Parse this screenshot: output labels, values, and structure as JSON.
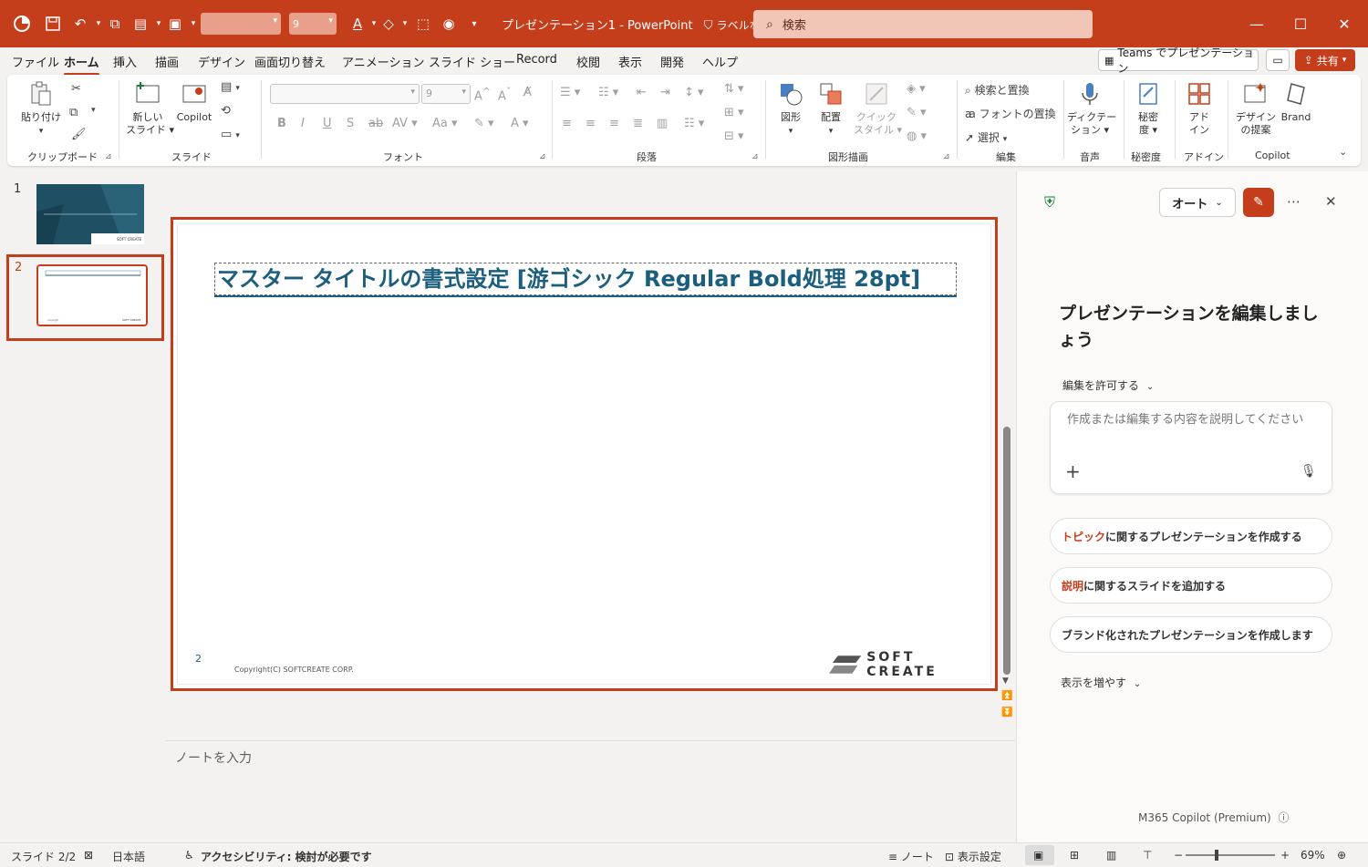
{
  "colors": {
    "accent": "#c43e1c",
    "title_text": "#1b5e7e",
    "slide1_bg": "#1f4f63"
  },
  "titlebar": {
    "doc_title": "プレゼンテーション1 - PowerPoint",
    "sensitivity": "ラベルなし",
    "search_placeholder": "検索",
    "font_size_value": "9"
  },
  "tabs": [
    "ファイル",
    "ホーム",
    "挿入",
    "描画",
    "デザイン",
    "画面切り替え",
    "アニメーション",
    "スライド ショー",
    "Record",
    "校閲",
    "表示",
    "開発",
    "ヘルプ"
  ],
  "active_tab": "ホーム",
  "tabbar_right": {
    "teams": "Teams でプレゼンテーション",
    "share": "共有"
  },
  "ribbon": {
    "groups": {
      "clipboard": "クリップボード",
      "slides": "スライド",
      "font": "フォント",
      "paragraph": "段落",
      "drawing": "図形描画",
      "editing": "編集",
      "voice": "音声",
      "sensitivity": "秘密度",
      "addins": "アドイン",
      "copilot": "Copilot"
    },
    "paste": "貼り付け",
    "new_slide_1": "新しい",
    "new_slide_2": "スライド",
    "copilot": "Copilot",
    "font_size": "9",
    "shapes": "図形",
    "arrange": "配置",
    "quick_style_1": "クイック",
    "quick_style_2": "スタイル",
    "find_replace": "検索と置換",
    "replace_font": "フォントの置換",
    "select": "選択",
    "dictate_1": "ディクテー",
    "dictate_2": "ション",
    "sensitivity_1": "秘密",
    "sensitivity_2": "度",
    "addins_1": "アド",
    "addins_2": "イン",
    "designer_1": "デザイン",
    "designer_2": "の提案",
    "brand": "Brand"
  },
  "thumbnails": [
    {
      "num": "1"
    },
    {
      "num": "2"
    }
  ],
  "slide": {
    "title": "マスター タイトルの書式設定 [游ゴシック Regular Bold処理 28pt]",
    "page_number": "2",
    "copyright": "Copyright(C) SOFTCREATE CORP.",
    "logo_text": "SOFT CREATE"
  },
  "notes_placeholder": "ノートを入力",
  "copilot": {
    "mode": "オート",
    "heading": "プレゼンテーションを編集しましょう",
    "permission": "編集を許可する",
    "prompt_placeholder": "作成または編集する内容を説明してください",
    "suggestions": [
      {
        "highlight": "トピック",
        "rest": "に関するプレゼンテーションを作成する"
      },
      {
        "highlight": "説明",
        "rest": "に関するスライドを追加する"
      },
      {
        "highlight": "",
        "rest": "ブランド化されたプレゼンテーションを作成します"
      }
    ],
    "show_more": "表示を増やす",
    "footer": "M365 Copilot (Premium)"
  },
  "statusbar": {
    "slide_pos": "スライド 2/2",
    "language": "日本語",
    "accessibility": "アクセシビリティ: 検討が必要です",
    "notes": "ノート",
    "display_settings": "表示設定",
    "zoom": "69%"
  }
}
